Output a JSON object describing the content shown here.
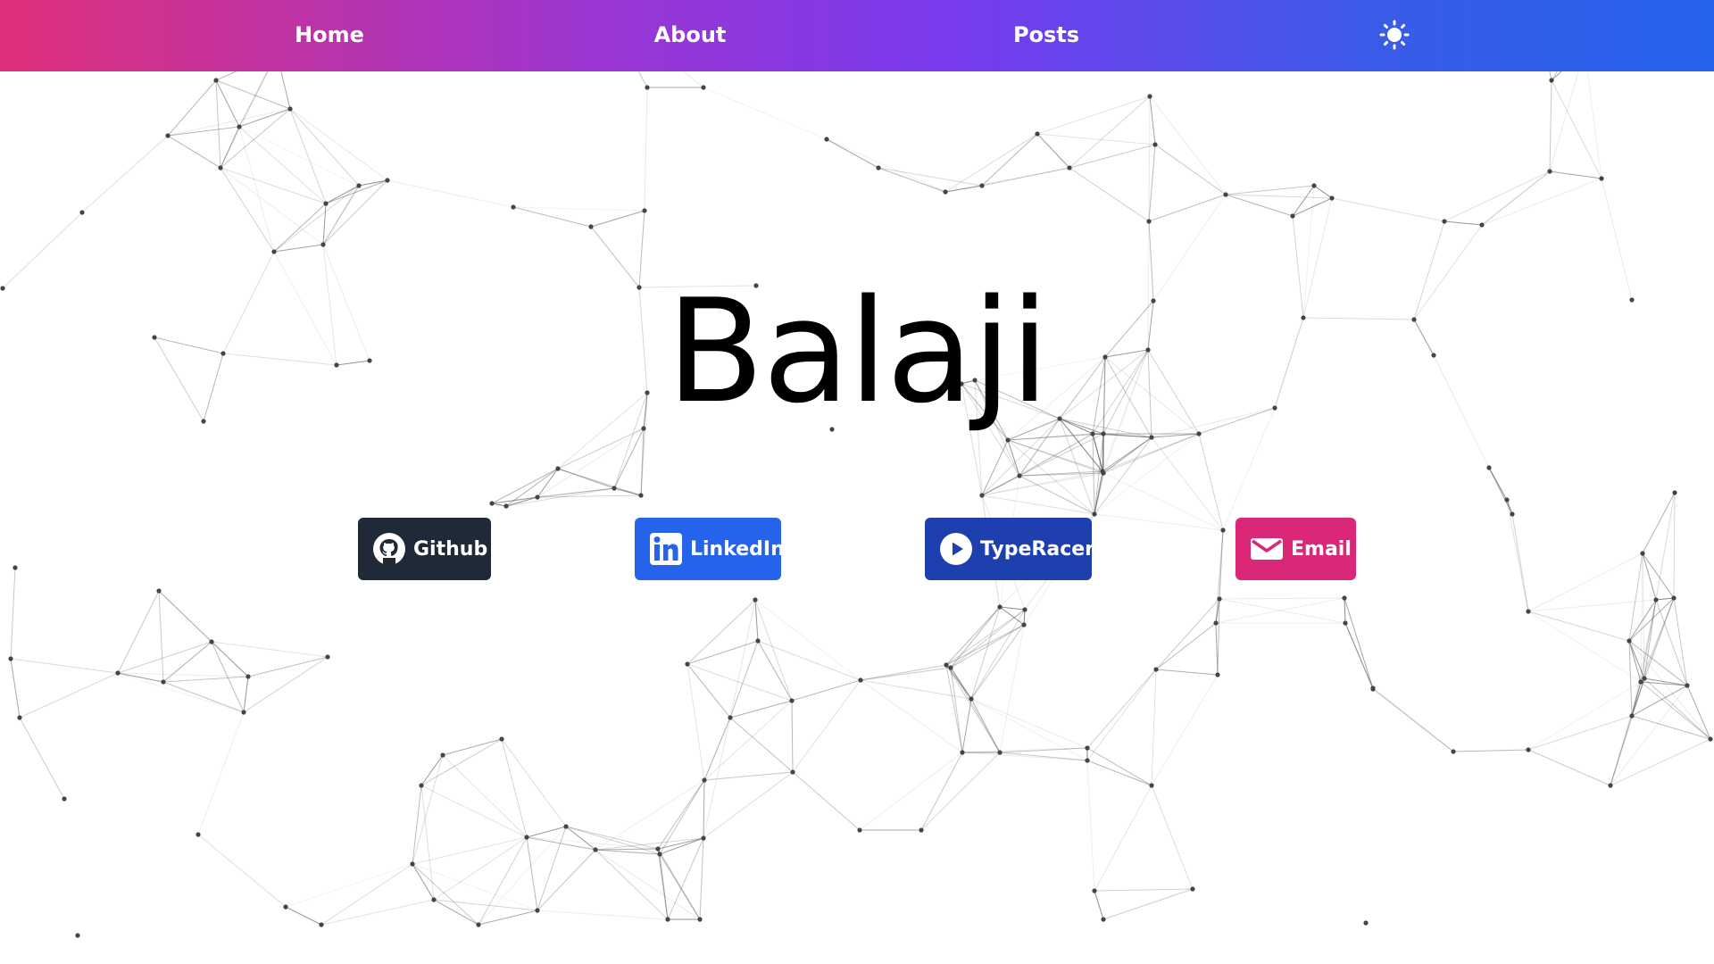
{
  "nav": {
    "items": [
      {
        "label": "Home"
      },
      {
        "label": "About"
      },
      {
        "label": "Posts"
      }
    ],
    "theme_toggle_icon": "sun-icon",
    "gradient": [
      "#e0307a",
      "#9b36d3",
      "#7a3aed",
      "#3b5be8",
      "#2563eb"
    ]
  },
  "hero": {
    "name": "Balaji"
  },
  "links": [
    {
      "label": "Github",
      "icon": "github-icon",
      "color": "#1f2937"
    },
    {
      "label": "LinkedIn",
      "icon": "linkedin-icon",
      "color": "#2563eb"
    },
    {
      "label": "TypeRacer",
      "icon": "play-circle-icon",
      "color": "#1e40af"
    },
    {
      "label": "Email",
      "icon": "mail-icon",
      "color": "#db2777"
    }
  ],
  "background": {
    "style": "particle-network",
    "line_color": "#555555",
    "node_color": "#444444"
  }
}
